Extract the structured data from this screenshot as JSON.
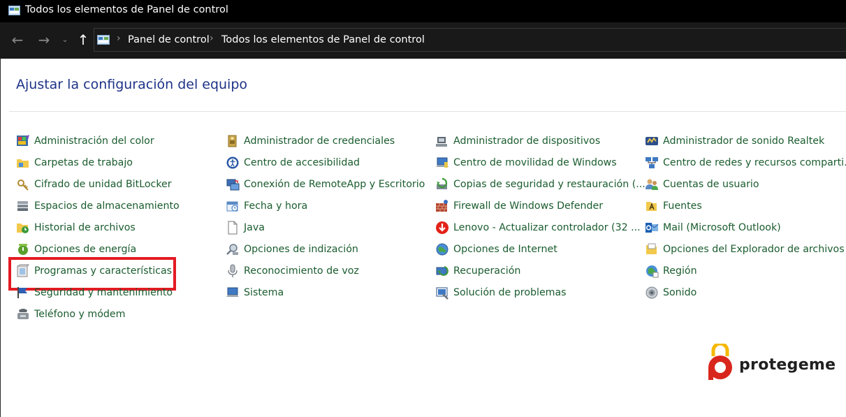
{
  "window": {
    "title": "Todos los elementos de Panel de control"
  },
  "nav": {
    "back": "←",
    "forward": "→",
    "recent": "⌄",
    "up": "↑"
  },
  "address": {
    "crumbs": [
      "Panel de control",
      "Todos los elementos de Panel de control"
    ],
    "separator": "›"
  },
  "page": {
    "title": "Ajustar la configuración del equipo"
  },
  "columns": [
    [
      {
        "label": "Administración del color",
        "icon": "color-management-icon"
      },
      {
        "label": "Carpetas de trabajo",
        "icon": "work-folders-icon"
      },
      {
        "label": "Cifrado de unidad BitLocker",
        "icon": "bitlocker-icon"
      },
      {
        "label": "Espacios de almacenamiento",
        "icon": "storage-spaces-icon"
      },
      {
        "label": "Historial de archivos",
        "icon": "file-history-icon"
      },
      {
        "label": "Opciones de energía",
        "icon": "power-options-icon"
      },
      {
        "label": "Programas y características",
        "icon": "programs-features-icon",
        "highlighted": true
      },
      {
        "label": "Seguridad y mantenimiento",
        "icon": "security-maintenance-icon"
      },
      {
        "label": "Teléfono y módem",
        "icon": "phone-modem-icon"
      }
    ],
    [
      {
        "label": "Administrador de credenciales",
        "icon": "credential-manager-icon"
      },
      {
        "label": "Centro de accesibilidad",
        "icon": "ease-of-access-icon"
      },
      {
        "label": "Conexión de RemoteApp y Escritorio",
        "icon": "remoteapp-icon"
      },
      {
        "label": "Fecha y hora",
        "icon": "date-time-icon"
      },
      {
        "label": "Java",
        "icon": "java-icon"
      },
      {
        "label": "Opciones de indización",
        "icon": "indexing-options-icon"
      },
      {
        "label": "Reconocimiento de voz",
        "icon": "speech-recognition-icon"
      },
      {
        "label": "Sistema",
        "icon": "system-icon"
      }
    ],
    [
      {
        "label": "Administrador de dispositivos",
        "icon": "device-manager-icon"
      },
      {
        "label": "Centro de movilidad de Windows",
        "icon": "mobility-center-icon"
      },
      {
        "label": "Copias de seguridad y restauración (...",
        "icon": "backup-restore-icon"
      },
      {
        "label": "Firewall de Windows Defender",
        "icon": "firewall-icon"
      },
      {
        "label": "Lenovo - Actualizar controlador (32 ...",
        "icon": "lenovo-update-icon"
      },
      {
        "label": "Opciones de Internet",
        "icon": "internet-options-icon"
      },
      {
        "label": "Recuperación",
        "icon": "recovery-icon"
      },
      {
        "label": "Solución de problemas",
        "icon": "troubleshooting-icon"
      }
    ],
    [
      {
        "label": "Administrador de sonido Realtek",
        "icon": "realtek-audio-icon"
      },
      {
        "label": "Centro de redes y recursos comparti...",
        "icon": "network-sharing-icon"
      },
      {
        "label": "Cuentas de usuario",
        "icon": "user-accounts-icon"
      },
      {
        "label": "Fuentes",
        "icon": "fonts-icon"
      },
      {
        "label": "Mail (Microsoft Outlook)",
        "icon": "mail-icon"
      },
      {
        "label": "Opciones del Explorador de archivos",
        "icon": "explorer-options-icon"
      },
      {
        "label": "Región",
        "icon": "region-icon"
      },
      {
        "label": "Sonido",
        "icon": "sound-icon"
      }
    ]
  ],
  "logo": {
    "text": "protegeme"
  },
  "colors": {
    "link": "#1a5c2e",
    "title": "#1e3287",
    "highlight": "#e31b23",
    "logo_accent": "#d9261c",
    "logo_lock": "#f5b800"
  }
}
